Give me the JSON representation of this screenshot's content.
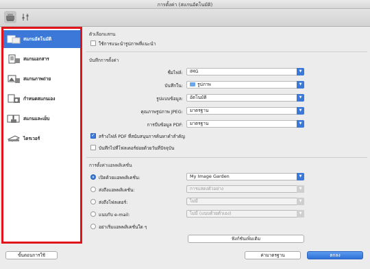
{
  "window": {
    "title": "การตั้งค่า (สแกนอัตโนมัติ)"
  },
  "toolbar": {
    "scan_icon": "scanner-icon",
    "settings_icon": "sliders-icon"
  },
  "sidebar": {
    "items": [
      {
        "label": "สแกนอัตโนมัติ",
        "icon": "auto-scan-icon"
      },
      {
        "label": "สแกนเอกสาร",
        "icon": "document-scan-icon"
      },
      {
        "label": "สแกนภาพถ่าย",
        "icon": "photo-scan-icon"
      },
      {
        "label": "กำหนดสแกนเอง",
        "icon": "custom-scan-icon"
      },
      {
        "label": "สแกนและเย็บ",
        "icon": "stitch-scan-icon"
      },
      {
        "label": "ไดรเวอร์",
        "icon": "driver-icon"
      }
    ]
  },
  "scan_options": {
    "title": "ตัวเลือกแสกน",
    "recommended_label": "ใช้การแนะนำรูปภาพที่แนะนำ"
  },
  "save_settings": {
    "title": "บันทึกการตั้งค่า",
    "file_name_label": "ชื่อไฟล์:",
    "file_name_value": "IMG",
    "save_in_label": "บันทึกใน:",
    "save_in_value": "รูปภาพ",
    "data_format_label": "รูปแบบข้อมูล:",
    "data_format_value": "อัตโนมัติ",
    "jpeg_quality_label": "คุณภาพรูปภาพ JPEG:",
    "jpeg_quality_value": "มาตรฐาน",
    "pdf_compression_label": "การบีบข้อมูล PDF:",
    "pdf_compression_value": "มาตรฐาน",
    "keyword_pdf_label": "สร้างไฟล์ PDF ที่สนับสนุนการค้นหาคำสำคัญ",
    "subfolder_label": "บันทึกไปที่โฟลเดอร์ย่อยด้วยวันที่ปัจจุบัน"
  },
  "app_settings": {
    "title": "การตั้งค่าแอพพลิเคชั่น",
    "open_app_label": "เปิดด้วยแอพพลิเคชั่น:",
    "open_app_value": "My Image Garden",
    "send_app_label": "ส่งถึงแอพพลิเคชั่น:",
    "send_app_value": "การแสดงตัวอย่าง",
    "send_folder_label": "ส่งถึงโฟลเดอร์:",
    "send_folder_value": "ไม่มี",
    "email_label": "แนบกับ e-mail:",
    "email_value": "ไม่มี (แนบด้วยตัวเอง)",
    "no_app_label": "อย่าเริ่มแอพพลิเคชั่นใด ๆ",
    "more_functions_label": "ฟังก์ชันเพิ่มเติม"
  },
  "footer": {
    "instructions_label": "ขั้นตอนการใช้",
    "defaults_label": "ค่ามาตรฐาน",
    "ok_label": "ตกลง"
  },
  "colors": {
    "accent": "#3b78d8",
    "highlight_border": "#e0131a"
  }
}
